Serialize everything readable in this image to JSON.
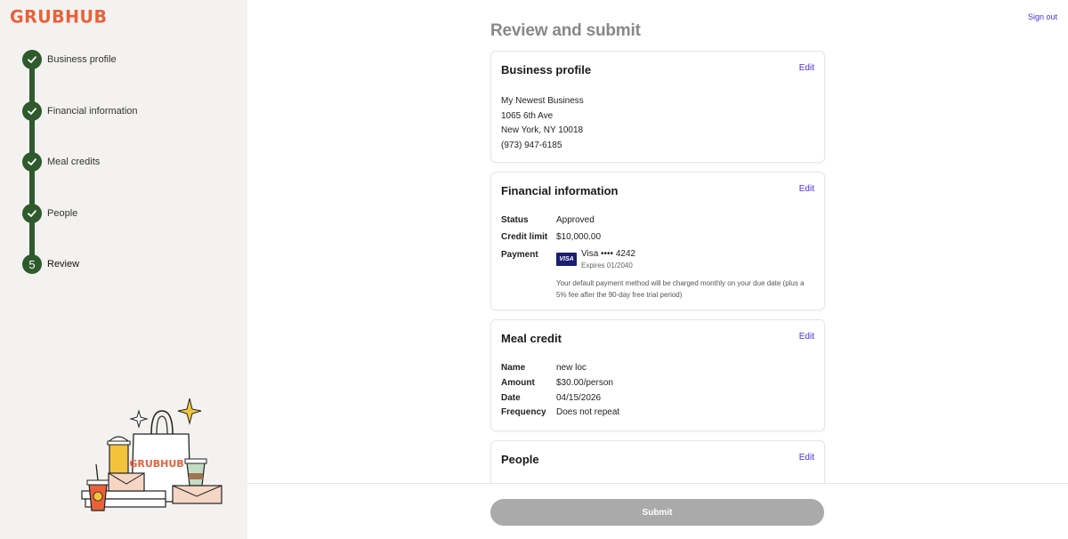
{
  "brand": {
    "logo_text": "GRUBHUB",
    "accent": "#e8613a",
    "step_color": "#2e5a2e",
    "link_color": "#4a2fd6"
  },
  "header": {
    "signout_label": "Sign out",
    "title": "Review and submit"
  },
  "steps": [
    {
      "label": "Business profile",
      "status": "complete",
      "icon": "check-icon"
    },
    {
      "label": "Financial information",
      "status": "complete",
      "icon": "check-icon"
    },
    {
      "label": "Meal credits",
      "status": "complete",
      "icon": "check-icon"
    },
    {
      "label": "People",
      "status": "complete",
      "icon": "check-icon"
    },
    {
      "label": "Review",
      "status": "current",
      "number": "5"
    }
  ],
  "illustration": {
    "bag_text": "GRUBHUB"
  },
  "business_profile": {
    "title": "Business profile",
    "edit_label": "Edit",
    "lines": [
      "My Newest Business",
      "1065 6th Ave",
      "New York, NY 10018",
      "(973) 947-6185"
    ]
  },
  "financial": {
    "title": "Financial information",
    "edit_label": "Edit",
    "status_label": "Status",
    "status_value": "Approved",
    "credit_label": "Credit limit",
    "credit_value": "$10,000.00",
    "payment_label": "Payment",
    "card_badge": "VISA",
    "card_text": "Visa •••• 4242",
    "card_expiry": "Expires 01/2040",
    "note": "Your default payment method will be charged monthly on your due date (plus a 5% fee after the 90-day free trial period)"
  },
  "meal_credit": {
    "title": "Meal credit",
    "edit_label": "Edit",
    "name_label": "Name",
    "name_value": "new loc",
    "amount_label": "Amount",
    "amount_value": "$30.00/person",
    "date_label": "Date",
    "date_value": "04/15/2026",
    "frequency_label": "Frequency",
    "frequency_value": "Does not repeat"
  },
  "people": {
    "title": "People",
    "edit_label": "Edit"
  },
  "footer": {
    "submit_label": "Submit"
  }
}
